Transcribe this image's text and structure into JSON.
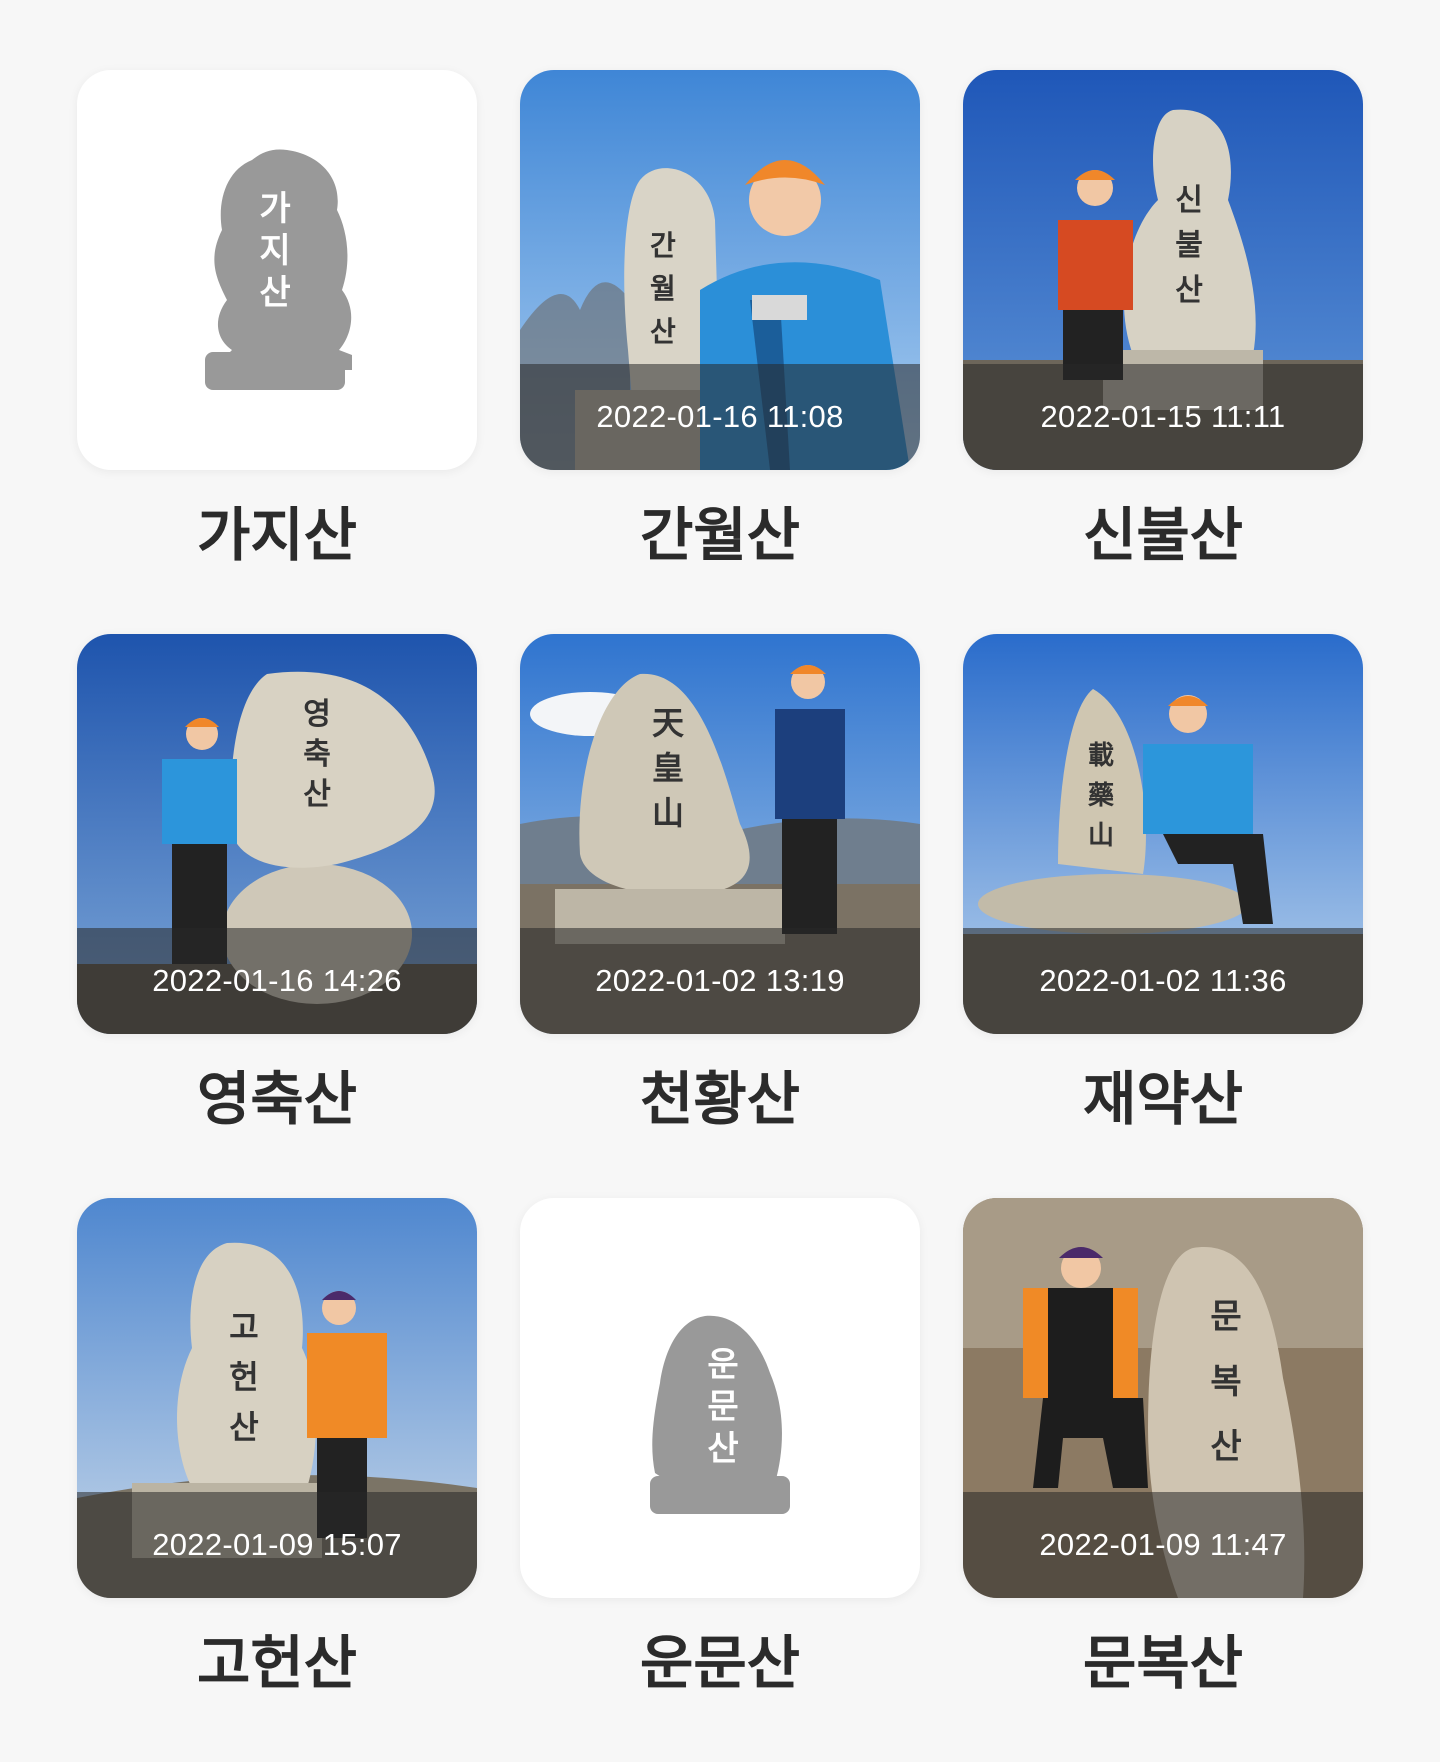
{
  "mountains": [
    {
      "name": "가지산",
      "date": "",
      "has_photo": false,
      "stone_text": "가지산"
    },
    {
      "name": "간월산",
      "date": "2022-01-16 11:08",
      "has_photo": true,
      "stone_text": "간월산"
    },
    {
      "name": "신불산",
      "date": "2022-01-15 11:11",
      "has_photo": true,
      "stone_text": "신불산"
    },
    {
      "name": "영축산",
      "date": "2022-01-16 14:26",
      "has_photo": true,
      "stone_text": "영축산"
    },
    {
      "name": "천황산",
      "date": "2022-01-02 13:19",
      "has_photo": true,
      "stone_text": "天皇山"
    },
    {
      "name": "재약산",
      "date": "2022-01-02 11:36",
      "has_photo": true,
      "stone_text": "載藥山"
    },
    {
      "name": "고헌산",
      "date": "2022-01-09 15:07",
      "has_photo": true,
      "stone_text": "고헌산"
    },
    {
      "name": "운문산",
      "date": "",
      "has_photo": false,
      "stone_text": "운문산"
    },
    {
      "name": "문복산",
      "date": "2022-01-09 11:47",
      "has_photo": true,
      "stone_text": "문복산"
    }
  ],
  "colors": {
    "background": "#f7f7f7",
    "card": "#ffffff",
    "placeholder_stone": "#999999",
    "name_text": "#2b2b2b",
    "date_overlay": "rgba(40,40,40,0.55)"
  },
  "icons": {
    "placeholder": "summit-stone-icon"
  }
}
